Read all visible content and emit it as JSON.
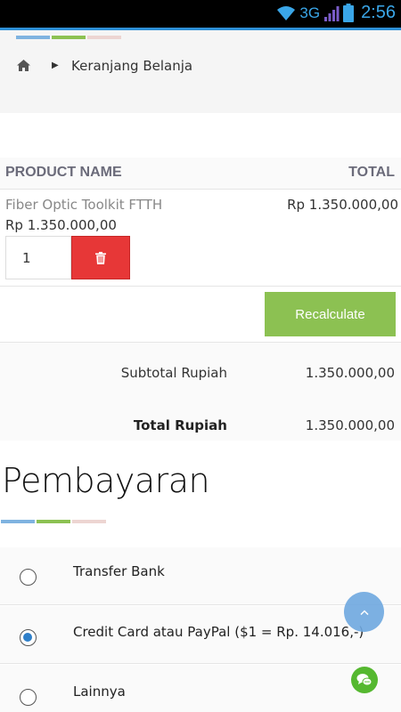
{
  "status_bar": {
    "network": "3G",
    "time": "2:56"
  },
  "breadcrumb": {
    "home_icon": "home-icon",
    "separator_icon": "caret-right-icon",
    "label": "Keranjang Belanja"
  },
  "cart": {
    "headers": {
      "product_name": "PRODUCT NAME",
      "total": "TOTAL"
    },
    "items": [
      {
        "name": "Fiber Optic Toolkit FTTH",
        "price": "Rp 1.350.000,00",
        "quantity": "1",
        "total": "Rp 1.350.000,00"
      }
    ],
    "recalculate_label": "Recalculate",
    "subtotal_label": "Subtotal Rupiah",
    "subtotal_value": "1.350.000,00",
    "total_label": "Total Rupiah",
    "total_value": "1.350.000,00"
  },
  "payment": {
    "title": "Pembayaran",
    "options": [
      {
        "label": "Transfer Bank",
        "selected": false
      },
      {
        "label": "Credit Card atau PayPal ($1 = Rp. 14.016,-)",
        "selected": true
      },
      {
        "label": "Lainnya",
        "selected": false
      }
    ]
  },
  "colors": {
    "accent_blue": "#7fb3e0",
    "accent_green": "#8cc152",
    "accent_pink": "#edd5d2",
    "delete_red": "#e73737",
    "radio_selected": "#2e7fc9"
  }
}
